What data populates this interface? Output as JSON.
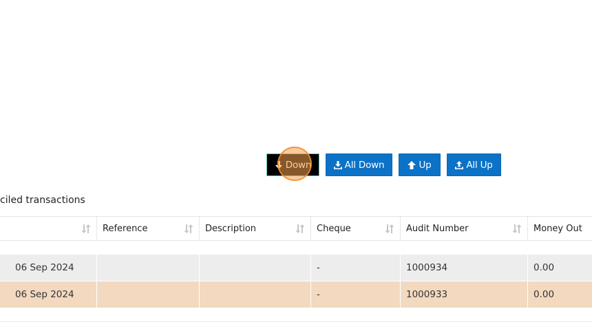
{
  "toolbar": {
    "down_label": "Down",
    "all_down_label": "All Down",
    "up_label": "Up",
    "all_up_label": "All Up"
  },
  "section": {
    "title": "ciled transactions"
  },
  "table": {
    "columns": [
      "",
      "Reference",
      "Description",
      "Cheque",
      "Audit Number",
      "Money Out"
    ],
    "rows": [
      {
        "date": "06 Sep 2024",
        "reference": "",
        "description": "",
        "cheque": "-",
        "audit_number": "1000934",
        "money_out": "0.00"
      },
      {
        "date": "06 Sep 2024",
        "reference": "",
        "description": "",
        "cheque": "-",
        "audit_number": "1000933",
        "money_out": "0.00"
      }
    ]
  },
  "icons": {
    "down": "arrow-down-icon",
    "all_down": "download-tray-icon",
    "up": "arrow-up-icon",
    "all_up": "upload-tray-icon",
    "sort": "sort-icon"
  },
  "colors": {
    "primary_button": "#0b72c7",
    "active_button": "#000000",
    "row_alternate": "#eeeded",
    "row_highlight": "#f2d9c0",
    "click_indicator": "#f6a04b"
  }
}
